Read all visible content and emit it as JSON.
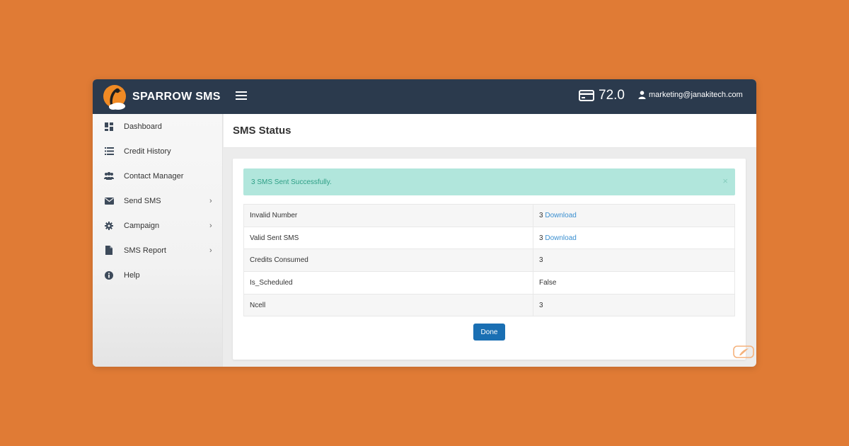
{
  "brand": {
    "name": "SPARROW SMS"
  },
  "header": {
    "credit_balance": "72.0",
    "user_email": "marketing@janakitech.com"
  },
  "sidebar": {
    "items": [
      {
        "label": "Dashboard",
        "icon": "dashboard-icon",
        "has_submenu": false
      },
      {
        "label": "Credit History",
        "icon": "list-icon",
        "has_submenu": false
      },
      {
        "label": "Contact Manager",
        "icon": "users-icon",
        "has_submenu": false
      },
      {
        "label": "Send SMS",
        "icon": "envelope-icon",
        "has_submenu": true
      },
      {
        "label": "Campaign",
        "icon": "gear-icon",
        "has_submenu": true
      },
      {
        "label": "SMS Report",
        "icon": "file-icon",
        "has_submenu": true
      },
      {
        "label": "Help",
        "icon": "info-icon",
        "has_submenu": false
      }
    ]
  },
  "page": {
    "title": "SMS Status"
  },
  "alert": {
    "message": "3 SMS Sent Successfully.",
    "close": "×"
  },
  "status_table": {
    "rows": [
      {
        "label": "Invalid Number",
        "value": "3",
        "link": "Download"
      },
      {
        "label": "Valid Sent SMS",
        "value": "3",
        "link": "Download"
      },
      {
        "label": "Credits Consumed",
        "value": "3"
      },
      {
        "label": "Is_Scheduled",
        "value": "False"
      },
      {
        "label": "Ncell",
        "value": "3"
      }
    ]
  },
  "actions": {
    "done_label": "Done"
  },
  "colors": {
    "background": "#e07b35",
    "topbar": "#2b3a4d",
    "alert_bg": "#b1e6dc",
    "alert_text": "#2e9f86",
    "link": "#3a8fd0",
    "primary_button": "#1a6fb3"
  }
}
